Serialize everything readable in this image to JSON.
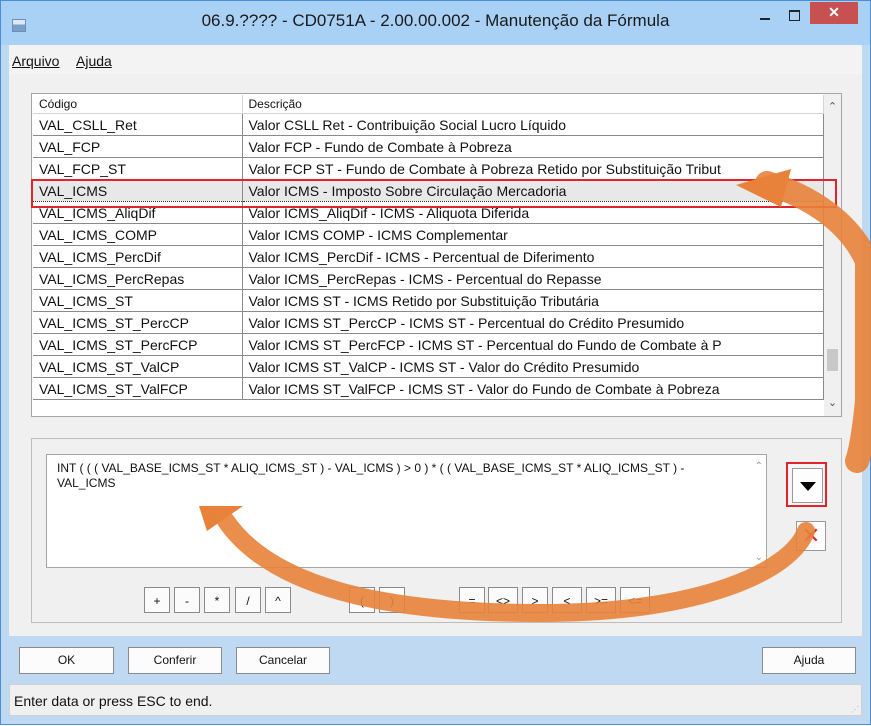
{
  "window": {
    "title": "06.9.???? - CD0751A - 2.00.00.002 - Manutenção da Fórmula",
    "close_label": "✕"
  },
  "menu": {
    "items": [
      {
        "label": "Arquivo"
      },
      {
        "label": "Ajuda"
      }
    ]
  },
  "grid": {
    "columns": [
      "Código",
      "Descrição"
    ],
    "rows": [
      {
        "code": "VAL_CSLL_Ret",
        "desc": "Valor CSLL Ret - Contribuição Social Lucro Líquido"
      },
      {
        "code": "VAL_FCP",
        "desc": "Valor FCP - Fundo de Combate à Pobreza"
      },
      {
        "code": "VAL_FCP_ST",
        "desc": "Valor FCP ST - Fundo de Combate à Pobreza Retido por Substituição Tribut"
      },
      {
        "code": "VAL_ICMS",
        "desc": "Valor ICMS - Imposto Sobre Circulação Mercadoria"
      },
      {
        "code": "VAL_ICMS_AliqDif",
        "desc": "Valor ICMS_AliqDif - ICMS - Aliquota Diferida"
      },
      {
        "code": "VAL_ICMS_COMP",
        "desc": "Valor ICMS COMP - ICMS Complementar"
      },
      {
        "code": "VAL_ICMS_PercDif",
        "desc": "Valor ICMS_PercDif - ICMS - Percentual de Diferimento"
      },
      {
        "code": "VAL_ICMS_PercRepas",
        "desc": "Valor ICMS_PercRepas - ICMS - Percentual do Repasse"
      },
      {
        "code": "VAL_ICMS_ST",
        "desc": "Valor ICMS ST - ICMS Retido por Substituição Tributária"
      },
      {
        "code": "VAL_ICMS_ST_PercCP",
        "desc": "Valor ICMS ST_PercCP - ICMS ST - Percentual do Crédito Presumido"
      },
      {
        "code": "VAL_ICMS_ST_PercFCP",
        "desc": "Valor ICMS ST_PercFCP - ICMS ST - Percentual do Fundo de Combate à P"
      },
      {
        "code": "VAL_ICMS_ST_ValCP",
        "desc": "Valor ICMS ST_ValCP - ICMS ST - Valor do Crédito Presumido"
      },
      {
        "code": "VAL_ICMS_ST_ValFCP",
        "desc": "Valor ICMS ST_ValFCP - ICMS ST - Valor do Fundo de Combate à Pobreza"
      }
    ],
    "selected_code": "VAL_ICMS"
  },
  "formula": {
    "text": "INT ( ( ( VAL_BASE_ICMS_ST * ALIQ_ICMS_ST ) - VAL_ICMS ) > 0 ) * ( ( VAL_BASE_ICMS_ST * ALIQ_ICMS_ST ) - VAL_ICMS",
    "clear_label": "✕"
  },
  "operators": [
    "+",
    "-",
    "*",
    "/",
    "^",
    "(",
    ")",
    "=",
    "<>",
    ">",
    "<",
    ">=",
    "<="
  ],
  "actions": {
    "ok": "OK",
    "conferir": "Conferir",
    "cancelar": "Cancelar",
    "ajuda": "Ajuda"
  },
  "status": {
    "text": "Enter data or press ESC to end."
  },
  "colors": {
    "highlight": "#e0242b",
    "arrow": "#e8823a",
    "titlebar": "#a9d0f5",
    "close": "#c75050"
  }
}
